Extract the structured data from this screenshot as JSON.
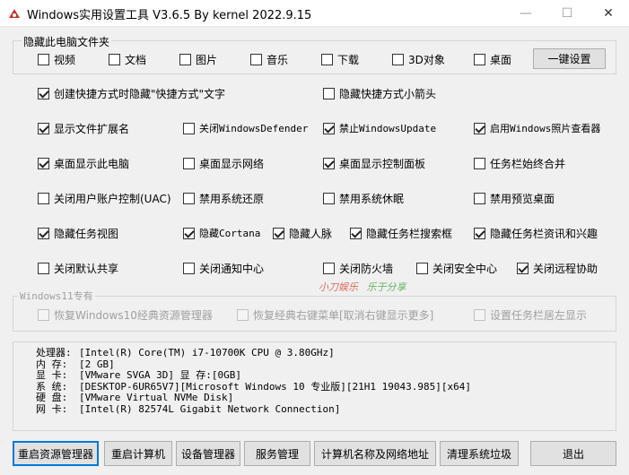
{
  "window": {
    "title": "Windows实用设置工具 V3.6.5 By kernel 2022.9.15",
    "controls": {
      "minimize": "—",
      "maximize": "☐",
      "close": "✕"
    }
  },
  "hide_group": {
    "title": "隐藏此电脑文件夹",
    "items": [
      {
        "label": "视频",
        "checked": false
      },
      {
        "label": "文档",
        "checked": false
      },
      {
        "label": "图片",
        "checked": false
      },
      {
        "label": "音乐",
        "checked": false
      },
      {
        "label": "下载",
        "checked": false
      },
      {
        "label": "3D对象",
        "checked": false
      },
      {
        "label": "桌面",
        "checked": false
      }
    ],
    "one_click_button": "一键设置"
  },
  "options": [
    {
      "label": "创建快捷方式时隐藏\"快捷方式\"文字",
      "checked": true
    },
    {
      "label": "隐藏快捷方式小箭头",
      "checked": false
    },
    {
      "label": "显示文件扩展名",
      "checked": true
    },
    {
      "label": "关闭WindowsDefender",
      "checked": false
    },
    {
      "label": "禁止WindowsUpdate",
      "checked": true
    },
    {
      "label": "启用Windows照片查看器",
      "checked": true
    },
    {
      "label": "桌面显示此电脑",
      "checked": true
    },
    {
      "label": "桌面显示网络",
      "checked": false
    },
    {
      "label": "桌面显示控制面板",
      "checked": true
    },
    {
      "label": "任务栏始终合并",
      "checked": false
    },
    {
      "label": "关闭用户账户控制(UAC)",
      "checked": false
    },
    {
      "label": "禁用系统还原",
      "checked": false
    },
    {
      "label": "禁用系统休眠",
      "checked": false
    },
    {
      "label": "禁用预览桌面",
      "checked": false
    },
    {
      "label": "隐藏任务视图",
      "checked": true
    },
    {
      "label": "隐藏Cortana",
      "checked": true
    },
    {
      "label": "隐藏人脉",
      "checked": true
    },
    {
      "label": "隐藏任务栏搜索框",
      "checked": true
    },
    {
      "label": "隐藏任务栏资讯和兴趣",
      "checked": true
    },
    {
      "label": "关闭默认共享",
      "checked": false
    },
    {
      "label": "关闭通知中心",
      "checked": false
    },
    {
      "label": "关闭防火墙",
      "checked": false
    },
    {
      "label": "关闭安全中心",
      "checked": false
    },
    {
      "label": "关闭远程协助",
      "checked": true
    }
  ],
  "win11_group": {
    "title": "Windows11专有",
    "items": [
      {
        "label": "恢复Windows10经典资源管理器",
        "checked": false
      },
      {
        "label": "恢复经典右键菜单[取消右键显示更多]",
        "checked": false
      },
      {
        "label": "设置任务栏居左显示",
        "checked": false
      }
    ]
  },
  "system_info": [
    {
      "label": "处理器:",
      "value": "[Intel(R) Core(TM) i7-10700K CPU @ 3.80GHz]"
    },
    {
      "label": "内  存:",
      "value": "[2 GB]"
    },
    {
      "label": "显  卡:",
      "value": "[VMware SVGA 3D]  显 存:[0GB]"
    },
    {
      "label": "系  统:",
      "value": "[DESKTOP-6UR65V7][Microsoft Windows 10 专业版][21H1 19043.985][x64]"
    },
    {
      "label": "硬  盘:",
      "value": "[VMware Virtual NVMe Disk]"
    },
    {
      "label": "网  卡:",
      "value": "[Intel(R) 82574L Gigabit Network Connection]"
    }
  ],
  "watermark": {
    "part1": "小刀娱乐",
    "part2": "乐于分享"
  },
  "buttons": [
    "重启资源管理器",
    "重启计算机",
    "设备管理器",
    "服务管理",
    "计算机名称及网络地址",
    "清理系统垃圾",
    "退出"
  ],
  "colors": {
    "accent": "#0078d7",
    "icon_red": "#c0392b",
    "watermark_red": "#d83a2a",
    "watermark_green": "#3aa035"
  }
}
